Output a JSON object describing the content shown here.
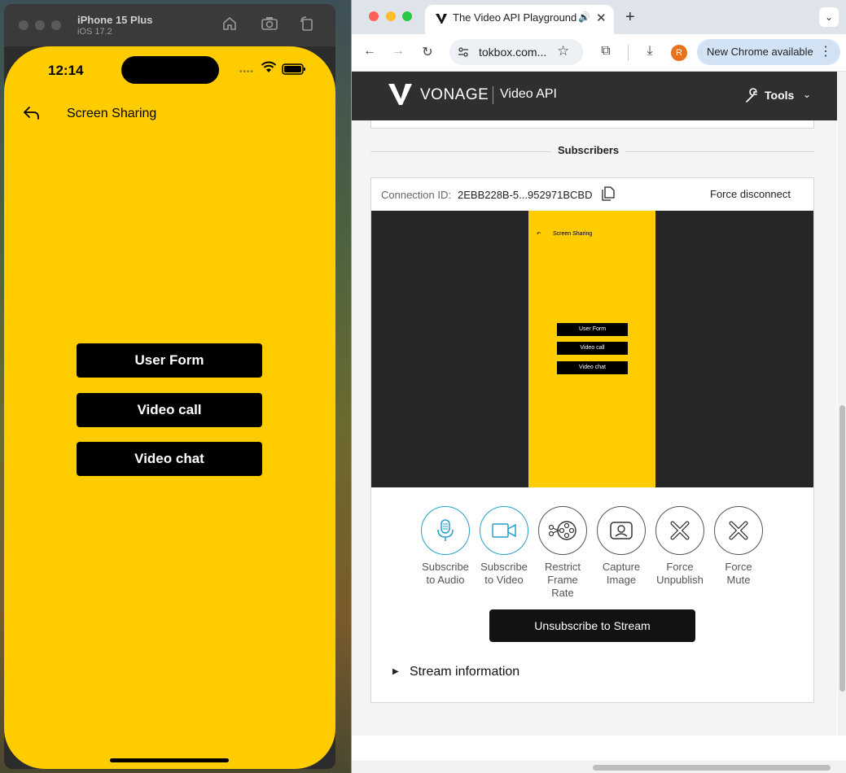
{
  "simulator": {
    "title": "iPhone 15 Plus",
    "subtitle": "iOS 17.2",
    "icons": [
      "home-icon",
      "screenshot-icon",
      "rotate-icon"
    ]
  },
  "phone": {
    "time": "12:14",
    "nav_title": "Screen Sharing",
    "buttons": [
      "User Form",
      "Video call",
      "Video chat"
    ],
    "background": "#ffcc00"
  },
  "browser": {
    "tab_title": "The Video API Playground",
    "url": "tokbox.com...",
    "profile_initial": "R",
    "update_label": "New Chrome available"
  },
  "app": {
    "brand": "VONAGE",
    "product": "Video API",
    "tools_label": "Tools",
    "section_title": "Subscribers",
    "connection_label": "Connection ID:",
    "connection_id": "2EBB228B-5...952971BCBD",
    "force_disconnect": "Force disconnect",
    "mini_preview": {
      "title": "Screen Sharing",
      "buttons": [
        "User Form",
        "Video call",
        "Video chat"
      ]
    },
    "controls": [
      {
        "line1": "Subscribe",
        "line2": "to Audio",
        "icon": "microphone-icon"
      },
      {
        "line1": "Subscribe",
        "line2": "to Video",
        "icon": "video-camera-icon"
      },
      {
        "line1": "Restrict",
        "line2": "Frame Rate",
        "icon": "film-reel-icon"
      },
      {
        "line1": "Capture",
        "line2": "Image",
        "icon": "capture-image-icon"
      },
      {
        "line1": "Force",
        "line2": "Unpublish",
        "icon": "close-circle-icon"
      },
      {
        "line1": "Force",
        "line2": "Mute",
        "icon": "close-circle-icon"
      }
    ],
    "unsubscribe_label": "Unsubscribe to Stream",
    "stream_info_label": "Stream information",
    "accent": "#26a0c8"
  }
}
